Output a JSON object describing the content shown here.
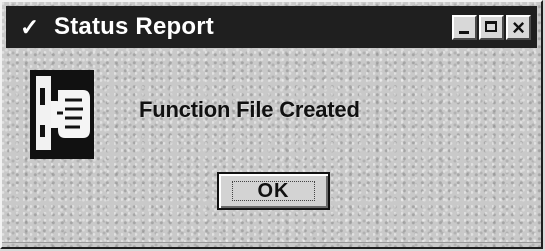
{
  "window": {
    "title": "Status Report",
    "title_icon": "check-icon"
  },
  "titlebar_buttons": [
    {
      "name": "minimize",
      "icon": "minimize-icon"
    },
    {
      "name": "maximize",
      "icon": "maximize-icon"
    },
    {
      "name": "close",
      "icon": "close-icon",
      "label": "×"
    }
  ],
  "message": {
    "icon": "document-report-icon",
    "text": "Function File Created"
  },
  "actions": {
    "ok_label": "OK"
  },
  "colors": {
    "titlebar": "#1f1f1f",
    "background": "#c9c9c9",
    "text": "#111111"
  }
}
